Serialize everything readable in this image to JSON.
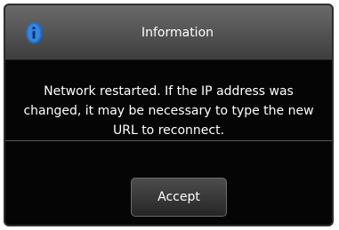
{
  "dialog": {
    "title": "Information",
    "icon": "info-icon",
    "message": "Network restarted. If the IP address was changed, it may be necessary to type the new URL to reconnect.",
    "accept_label": "Accept"
  },
  "colors": {
    "background": "#050505",
    "titlebar": "#555555",
    "icon": "#1e6fd0",
    "text": "#ffffff"
  }
}
